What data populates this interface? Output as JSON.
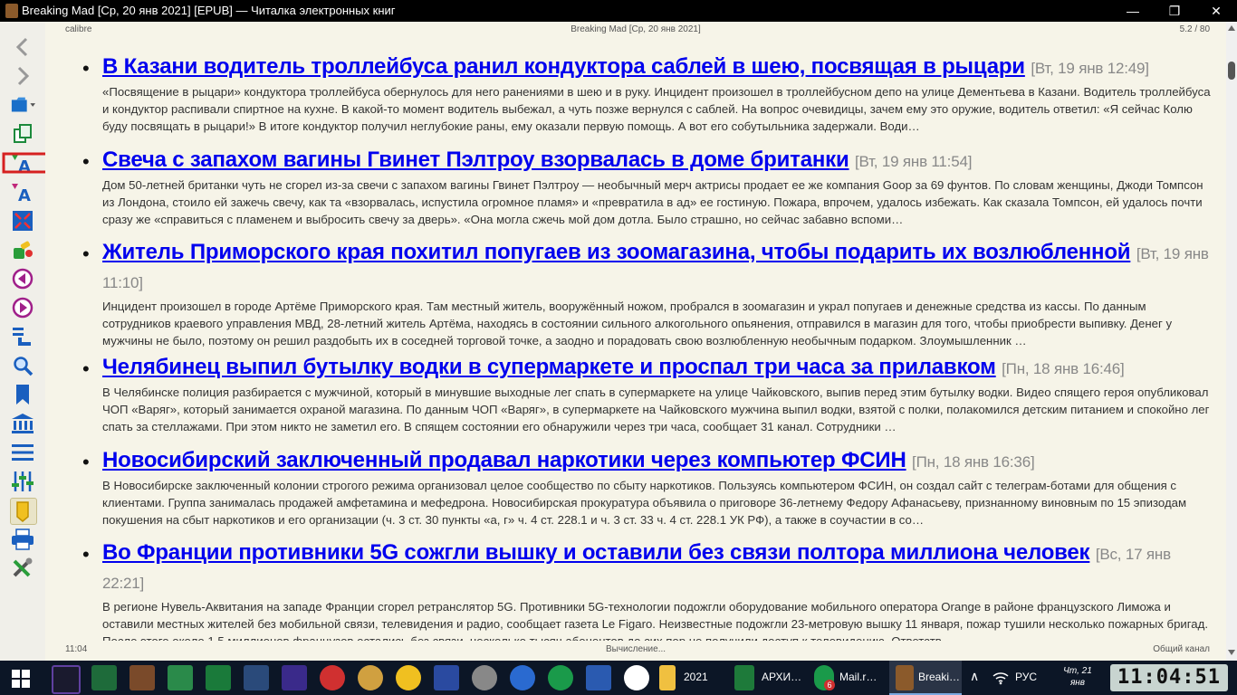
{
  "window": {
    "title": "Breaking Mad [Ср, 20 янв 2021] [EPUB] — Читалка электронных книг",
    "min_glyph": "—",
    "max_glyph": "❐",
    "close_glyph": "✕"
  },
  "reader": {
    "header_left": "calibre",
    "header_center": "Breaking Mad [Ср, 20 янв 2021]",
    "header_right": "5.2 / 80",
    "footer_left": "11:04",
    "footer_center": "Вычисление...",
    "footer_right": "Общий канал"
  },
  "articles": [
    {
      "headline": "В Казани водитель троллейбуса ранил кондуктора саблей в шею, посвящая в рыцари",
      "date": "[Вт, 19 янв 12:49]",
      "body": "«Посвящение в рыцари» кондуктора троллейбуса обернулось для него ранениями в шею и в руку. Инцидент произошел в троллейбусном депо на улице Дементьева в Казани. Водитель троллейбуса и кондуктор распивали спиртное на кухне. В какой-то момент водитель выбежал, а чуть позже вернулся с саблей. На вопрос очевидицы, зачем ему это оружие, водитель ответил: «Я сейчас Колю буду посвящать в рыцари!» В итоге кондуктор получил неглубокие раны, ему оказали первую помощь. А вот его собутыльника задержали. Води…"
    },
    {
      "headline": "Свеча с запахом вагины Гвинет Пэлтроу взорвалась в доме британки",
      "date": "[Вт, 19 янв 11:54]",
      "body": "Дом 50-летней британки чуть не сгорел из-за свечи с запахом вагины Гвинет Пэлтроу — необычный мерч актрисы продает ее же компания Goop за 69 фунтов. По словам женщины, Джоди Томпсон из Лондона, стоило ей зажечь свечу, как та «взорвалась, испустила огромное пламя» и «превратила в ад» ее гостиную. Пожара, впрочем, удалось избежать. Как сказала Томпсон, ей удалось почти сразу же «справиться с пламенем и выбросить свечу за дверь». «Она могла сжечь мой дом дотла. Было страшно, но сейчас забавно вспоми…"
    },
    {
      "headline": "Житель Приморского края похитил попугаев из зоомагазина, чтобы подарить их возлюбленной",
      "date": "[Вт, 19 янв 11:10]",
      "body": "Инцидент произошел в городе Артёме Приморского края. Там местный житель, вооружённый ножом, пробрался в зоомагазин и украл попугаев и денежные средства из кассы. По данным сотрудников краевого управления МВД, 28-летний житель Артёма, находясь в состоянии сильного алкогольного опьянения, отправился в магазин для того, чтобы приобрести выпивку. Денег у мужчины не было, поэтому он решил раздобыть их в соседней торговой точке, а заодно и порадовать свою возлюбленную необычным подарком. Злоумышленник …"
    },
    {
      "headline": "Челябинец выпил бутылку водки в супермаркете и проспал три часа за прилавком",
      "date": "[Пн, 18 янв 16:46]",
      "body": "В Челябинске полиция разбирается с мужчиной, который в минувшие выходные лег спать в супермаркете на улице Чайковского, выпив перед этим бутылку водки. Видео спящего героя опубликовал ЧОП «Варяг», который занимается охраной магазина. По данным ЧОП «Варяг», в супермаркете на Чайковского мужчина выпил водки, взятой с полки, полакомился детским питанием и спокойно лег спать за стеллажами. При этом никто не заметил его. В спящем состоянии его обнаружили через три часа, сообщает 31 канал. Сотрудники …"
    },
    {
      "headline": "Новосибирский заключенный продавал наркотики через компьютер ФСИН",
      "date": "[Пн, 18 янв 16:36]",
      "body": "В Новосибирске заключенный колонии строгого режима организовал целое сообщество по сбыту наркотиков. Пользуясь компьютером ФСИН, он создал сайт с телеграм-ботами для общения с клиентами. Группа занималась продажей амфетамина и мефедрона. Новосибирская прокуратура объявила о приговоре 36-летнему Федору Афанасьеву, признанному виновным по 15 эпизодам покушения на сбыт наркотиков и его организации (ч. 3 ст. 30 пункты «а, г» ч. 4 ст. 228.1 и ч. 3 ст. 33 ч. 4 ст. 228.1 УК РФ), а также в соучастии в со…"
    },
    {
      "headline": "Во Франции противники 5G сожгли вышку и оставили без связи полтора миллиона человек",
      "date": "[Вс, 17 янв 22:21]",
      "body": "В регионе Нувель-Аквитания на западе Франции сгорел ретранслятор 5G. Противники 5G-технологии подожгли оборудование мобильного оператора Orange в районе французского Лиможа и оставили местных жителей без мобильной связи, телевидения и радио, сообщает газета Le Figaro. Неизвестные подожгли 23-метровую вышку 11 января, пожар тушили несколько пожарных бригад. После этого около 1,5 миллионов французов остались без связи, несколько тысяч абонентов до сих пор не получили доступ к телевидению. Ответств…"
    }
  ],
  "sidebar": {
    "tools": [
      {
        "name": "back-icon",
        "glyph": "❮"
      },
      {
        "name": "forward-icon",
        "glyph": "❯"
      },
      {
        "name": "open-book-icon",
        "glyph": "📂"
      },
      {
        "name": "copy-icon",
        "glyph": "⧉"
      },
      {
        "name": "font-larger-icon",
        "glyph": "A"
      },
      {
        "name": "font-smaller-icon",
        "glyph": "A"
      },
      {
        "name": "fullscreen-icon",
        "glyph": "⤢"
      },
      {
        "name": "preferences-icon",
        "glyph": "✎"
      },
      {
        "name": "previous-page-icon",
        "glyph": "◀"
      },
      {
        "name": "next-page-icon",
        "glyph": "▶"
      },
      {
        "name": "goto-location-icon",
        "glyph": "↳"
      },
      {
        "name": "search-icon",
        "glyph": "⌕"
      },
      {
        "name": "bookmarks-icon",
        "glyph": "🔖"
      },
      {
        "name": "reference-mode-icon",
        "glyph": "🏛"
      },
      {
        "name": "table-of-contents-icon",
        "glyph": "☰"
      },
      {
        "name": "toggle-toolbars-icon",
        "glyph": "⚙"
      },
      {
        "name": "highlight-icon",
        "glyph": "✏"
      },
      {
        "name": "print-icon",
        "glyph": "⎙"
      },
      {
        "name": "settings-tools-icon",
        "glyph": "✖"
      }
    ],
    "accent": "#d62020"
  },
  "taskbar": {
    "items": [
      {
        "name": "windows-start-icon"
      },
      {
        "name": "media-player-icon"
      },
      {
        "name": "mesh-app-icon"
      },
      {
        "name": "books-app-icon"
      },
      {
        "name": "library-app-icon"
      },
      {
        "name": "phone-app-icon"
      },
      {
        "name": "space-app-icon"
      },
      {
        "name": "galaxy-app-icon"
      },
      {
        "name": "cherry-app-icon"
      },
      {
        "name": "paint-app-icon"
      },
      {
        "name": "archicad-app-icon"
      },
      {
        "name": "arrow-app-icon"
      },
      {
        "name": "fs-app-icon"
      },
      {
        "name": "network-app-icon"
      },
      {
        "name": "mail-at-icon"
      },
      {
        "name": "word-icon"
      },
      {
        "name": "yandex-browser-icon"
      }
    ],
    "folder_label": "2021",
    "excel_label": "АРХИ…",
    "mail_label": "Mail.r…",
    "mail_badge": "6",
    "breaking_label": "Breaki…",
    "tray_chevron": "∧",
    "language": "РУС",
    "date_line1": "Чт, 21",
    "date_line2": "янв",
    "clock": "11:04:51"
  }
}
